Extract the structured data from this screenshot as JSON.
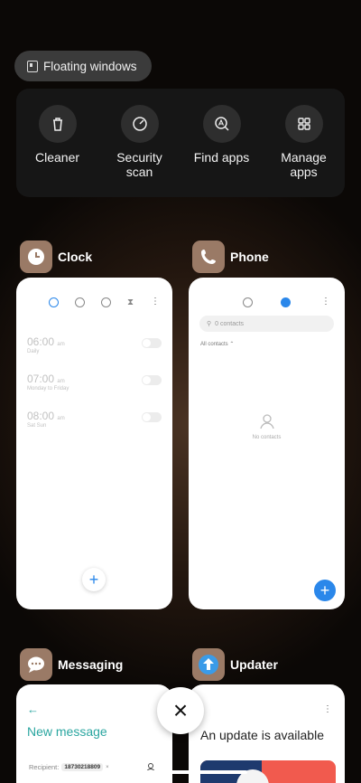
{
  "floating": {
    "label": "Floating windows"
  },
  "tools": [
    {
      "label": "Cleaner",
      "icon": "trash-icon"
    },
    {
      "label": "Security scan",
      "icon": "gauge-icon"
    },
    {
      "label": "Find apps",
      "icon": "find-apps-icon"
    },
    {
      "label": "Manage apps",
      "icon": "grid-icon"
    }
  ],
  "apps": {
    "clock": {
      "name": "Clock",
      "alarms": [
        {
          "time": "06:00",
          "ampm": "am",
          "sub": "Daily"
        },
        {
          "time": "07:00",
          "ampm": "am",
          "sub": "Monday to Friday"
        },
        {
          "time": "08:00",
          "ampm": "am",
          "sub": "Sat Sun"
        }
      ],
      "fab": "+"
    },
    "phone": {
      "name": "Phone",
      "search_placeholder": "0 contacts",
      "filter": "All contacts",
      "empty": "No contacts",
      "fab": "+"
    },
    "messaging": {
      "name": "Messaging",
      "back": "←",
      "title": "New message",
      "recipient_label": "Recipient:",
      "recipient_value": "18730218809"
    },
    "updater": {
      "name": "Updater",
      "title": "An update is available"
    }
  },
  "close": "×",
  "colors": {
    "accent": "#2a87ea",
    "app_icon_bg": "#9a7a66",
    "update_red": "#f15a4e",
    "update_navy": "#1e3a6e"
  }
}
